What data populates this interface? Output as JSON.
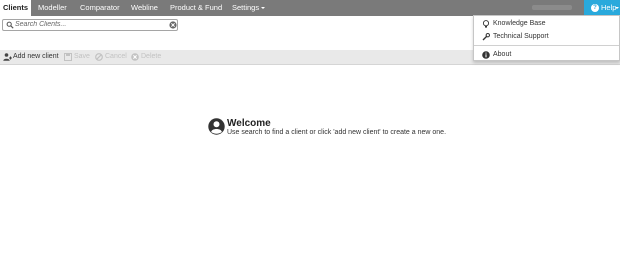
{
  "nav": {
    "tabs": [
      {
        "label": "Clients"
      },
      {
        "label": "Modeller"
      },
      {
        "label": "Comparator"
      },
      {
        "label": "Webline"
      },
      {
        "label": "Product & Fund"
      },
      {
        "label": "Settings"
      }
    ],
    "active_tab": "Clients",
    "help_label": "Help",
    "help_icon": "question-circle-icon"
  },
  "search": {
    "placeholder": "Search Clients...",
    "value": "",
    "icon": "search-icon",
    "clear_icon": "clear-icon"
  },
  "toolbar": {
    "add_client_label": "Add new client",
    "save_label": "Save",
    "cancel_label": "Cancel",
    "delete_label": "Delete"
  },
  "welcome": {
    "title": "Welcome",
    "message": "Use search to find a client or click 'add new client' to create a new one."
  },
  "help_menu": {
    "items": [
      {
        "label": "Knowledge Base",
        "icon": "lightbulb-icon"
      },
      {
        "label": "Technical Support",
        "icon": "wrench-icon"
      },
      {
        "label": "About",
        "icon": "info-icon"
      }
    ]
  },
  "colors": {
    "nav_bg": "#7a7a7a",
    "help_bg": "#29a9dc",
    "toolbar_bg": "#e9e9e9",
    "disabled_text": "#c2c2c2"
  }
}
